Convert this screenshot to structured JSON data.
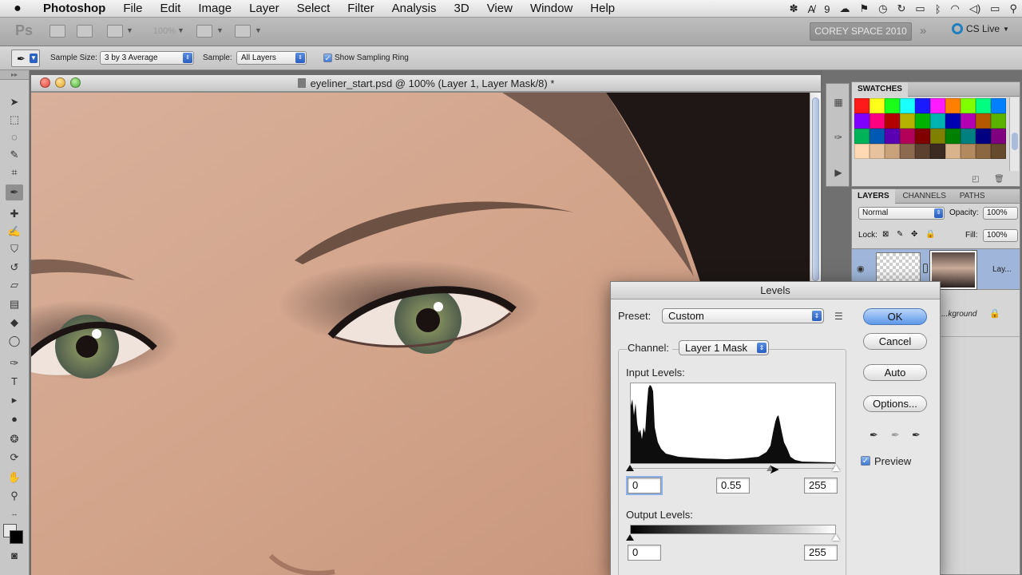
{
  "menubar": {
    "apple": "",
    "app": "Photoshop",
    "items": [
      "File",
      "Edit",
      "Image",
      "Layer",
      "Select",
      "Filter",
      "Analysis",
      "3D",
      "View",
      "Window",
      "Help"
    ],
    "tray_text": "9"
  },
  "appbar": {
    "logo": "Ps",
    "zoom": "100%",
    "workspace": "COREY SPACE 2010",
    "more": "»",
    "cs_live": "CS Live"
  },
  "options": {
    "sample_size_label": "Sample Size:",
    "sample_size_value": "3 by 3 Average",
    "sample_label": "Sample:",
    "sample_value": "All Layers",
    "show_ring_label": "Show Sampling Ring",
    "show_ring_checked": true
  },
  "document": {
    "title": "eyeliner_start.psd @ 100% (Layer 1, Layer Mask/8) *"
  },
  "panels": {
    "swatches_tab": "SWATCHES",
    "swatch_colors": [
      "#ff1a1a",
      "#ffff1a",
      "#1aff1a",
      "#1affff",
      "#1a1aff",
      "#ff1aff",
      "#ff8000",
      "#80ff00",
      "#00ff80",
      "#0080ff",
      "#8000ff",
      "#ff0080",
      "#b30000",
      "#b3b300",
      "#00b300",
      "#00b3b3",
      "#0000b3",
      "#b300b3",
      "#b35900",
      "#59b300",
      "#00b359",
      "#0059b3",
      "#5900b3",
      "#b30059",
      "#800000",
      "#808000",
      "#008000",
      "#008080",
      "#000080",
      "#800080",
      "#ffd9b3",
      "#e6c29e",
      "#c9a27c",
      "#8c6a4f",
      "#5c4030",
      "#3a2a20",
      "#d9b38c",
      "#b3895f",
      "#8c6640",
      "#664a2e"
    ],
    "layers_tabs": [
      "LAYERS",
      "CHANNELS",
      "PATHS"
    ],
    "blend_mode": "Normal",
    "opacity_label": "Opacity:",
    "opacity_value": "100%",
    "lock_label": "Lock:",
    "fill_label": "Fill:",
    "fill_value": "100%",
    "layer1_name": "Lay...",
    "background_name": "...kground"
  },
  "levels": {
    "title": "Levels",
    "preset_label": "Preset:",
    "preset_value": "Custom",
    "channel_label": "Channel:",
    "channel_value": "Layer 1 Mask",
    "input_levels_label": "Input Levels:",
    "input_black": "0",
    "input_mid": "0.55",
    "input_white": "255",
    "output_levels_label": "Output Levels:",
    "output_black": "0",
    "output_white": "255",
    "buttons": {
      "ok": "OK",
      "cancel": "Cancel",
      "auto": "Auto",
      "options": "Options..."
    },
    "preview_label": "Preview",
    "preview_checked": true
  }
}
